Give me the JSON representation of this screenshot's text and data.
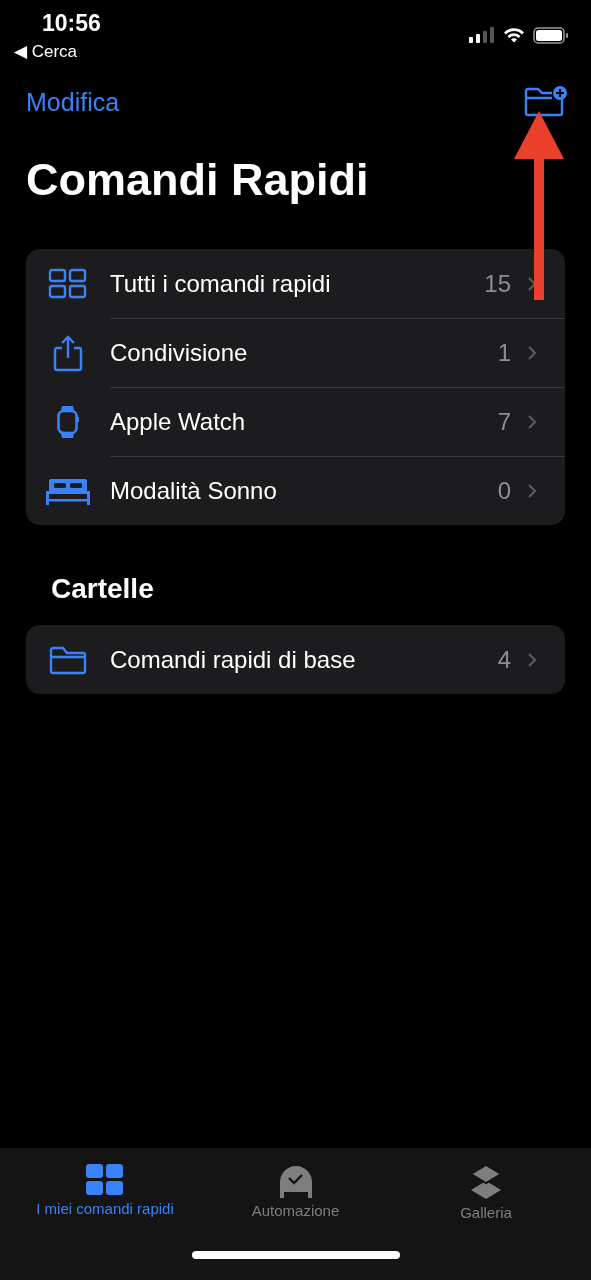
{
  "status_bar": {
    "time": "10:56",
    "back_link": "◀ Cerca"
  },
  "nav": {
    "edit": "Modifica"
  },
  "title": "Comandi Rapidi",
  "collections": [
    {
      "label": "Tutti i comandi rapidi",
      "count": "15"
    },
    {
      "label": "Condivisione",
      "count": "1"
    },
    {
      "label": "Apple Watch",
      "count": "7"
    },
    {
      "label": "Modalità Sonno",
      "count": "0"
    }
  ],
  "folders_heading": "Cartelle",
  "folders": [
    {
      "label": "Comandi rapidi di base",
      "count": "4"
    }
  ],
  "tabs": [
    {
      "label": "I miei comandi rapidi",
      "selected": true
    },
    {
      "label": "Automazione",
      "selected": false
    },
    {
      "label": "Galleria",
      "selected": false
    }
  ]
}
